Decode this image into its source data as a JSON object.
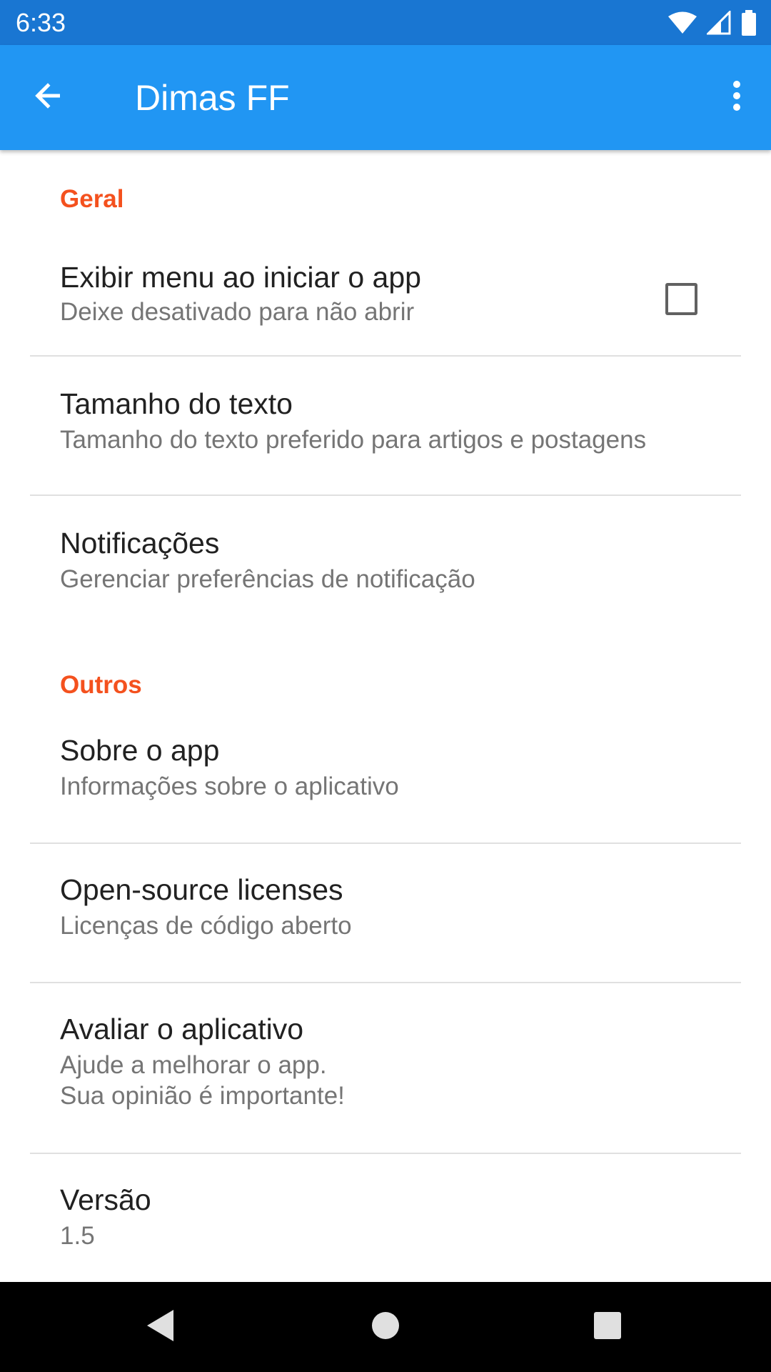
{
  "status_bar": {
    "time": "6:33",
    "icons": [
      "wifi-icon",
      "signal-icon",
      "battery-icon"
    ]
  },
  "app_bar": {
    "title": "Dimas FF",
    "back_icon": "arrow-back-icon",
    "menu_icon": "more-vert-icon"
  },
  "colors": {
    "status_bar": "#1976d2",
    "app_bar": "#2196f3",
    "category_accent": "#f4511e"
  },
  "sections": {
    "general": {
      "title": "Geral",
      "items": [
        {
          "title": "Exibir menu ao iniciar o app",
          "summary": "Deixe desativado para não abrir",
          "checked": false
        },
        {
          "title": "Tamanho do texto",
          "summary": "Tamanho do texto preferido para artigos e postagens"
        },
        {
          "title": "Notificações",
          "summary": "Gerenciar preferências de notificação"
        }
      ]
    },
    "others": {
      "title": "Outros",
      "items": [
        {
          "title": "Sobre o app",
          "summary": "Informações sobre o aplicativo"
        },
        {
          "title": "Open-source licenses",
          "summary": "Licenças de código aberto"
        },
        {
          "title": "Avaliar o aplicativo",
          "summary": "Ajude a melhorar o app.\nSua opinião é importante!"
        },
        {
          "title": "Versão",
          "summary": "1.5"
        }
      ]
    }
  },
  "nav_bar": {
    "icons": [
      "back-triangle-icon",
      "home-circle-icon",
      "recents-square-icon"
    ]
  }
}
